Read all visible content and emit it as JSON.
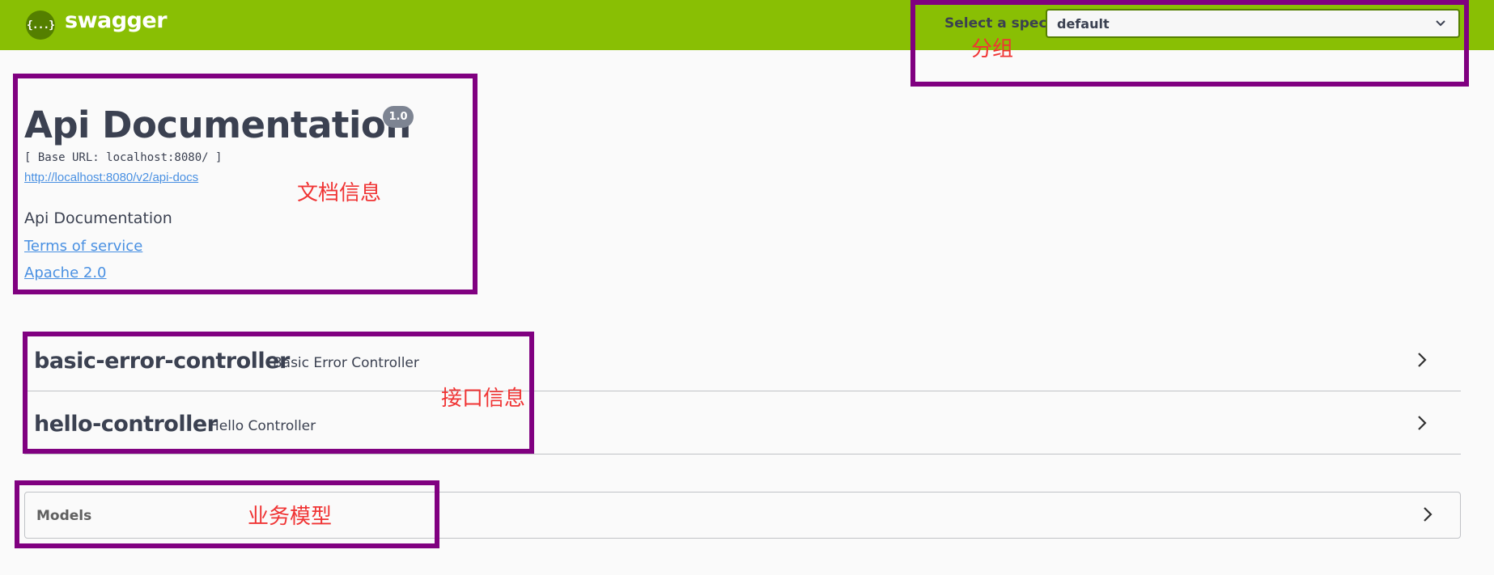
{
  "topbar": {
    "logo_icon": "{...}",
    "logo_text": "swagger",
    "spec_label": "Select a spec",
    "spec_value": "default",
    "chevron_icon": "chevron-down-icon"
  },
  "info": {
    "title": "Api Documentation",
    "version": "1.0",
    "base_url": "[ Base URL: localhost:8080/ ]",
    "api_docs_link": "http://localhost:8080/v2/api-docs",
    "description": "Api Documentation",
    "terms_of_service": "Terms of service",
    "license": "Apache 2.0"
  },
  "tags": [
    {
      "name": "basic-error-controller",
      "description": "Basic Error Controller",
      "icon": "chevron-right-icon"
    },
    {
      "name": "hello-controller",
      "description": "Hello Controller",
      "icon": "chevron-right-icon"
    }
  ],
  "models": {
    "label": "Models",
    "icon": "chevron-right-icon"
  },
  "annotations": {
    "group": "分组",
    "doc_info": "文档信息",
    "api_info": "接口信息",
    "business_model": "业务模型"
  },
  "colors": {
    "topbar": "#89bf04",
    "annotation_box": "#800080",
    "annotation_text": "#f03434",
    "link": "#4990e2",
    "text": "#3b4151"
  }
}
